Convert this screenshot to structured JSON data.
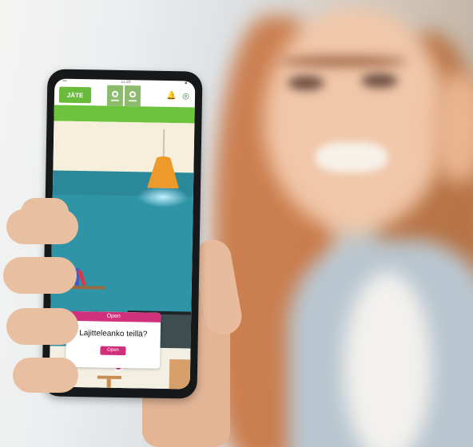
{
  "phone": {
    "status": {
      "left": "••• ",
      "time": "11:20",
      "right": "■"
    },
    "app_logo_text": "JÄTE",
    "tabs": [
      {
        "icon": "recycle-icon"
      },
      {
        "icon": "recycle-icon"
      }
    ],
    "icons": [
      "bell-icon",
      "user-icon"
    ],
    "popup": {
      "header": "Open",
      "title": "Lajitteleanko teillä?",
      "button": "Open"
    }
  },
  "colors": {
    "brand_green": "#6ec33d",
    "accent_pink": "#d1317c",
    "wall_teal": "#2f94a6",
    "lamp_orange": "#ee9a2a"
  }
}
